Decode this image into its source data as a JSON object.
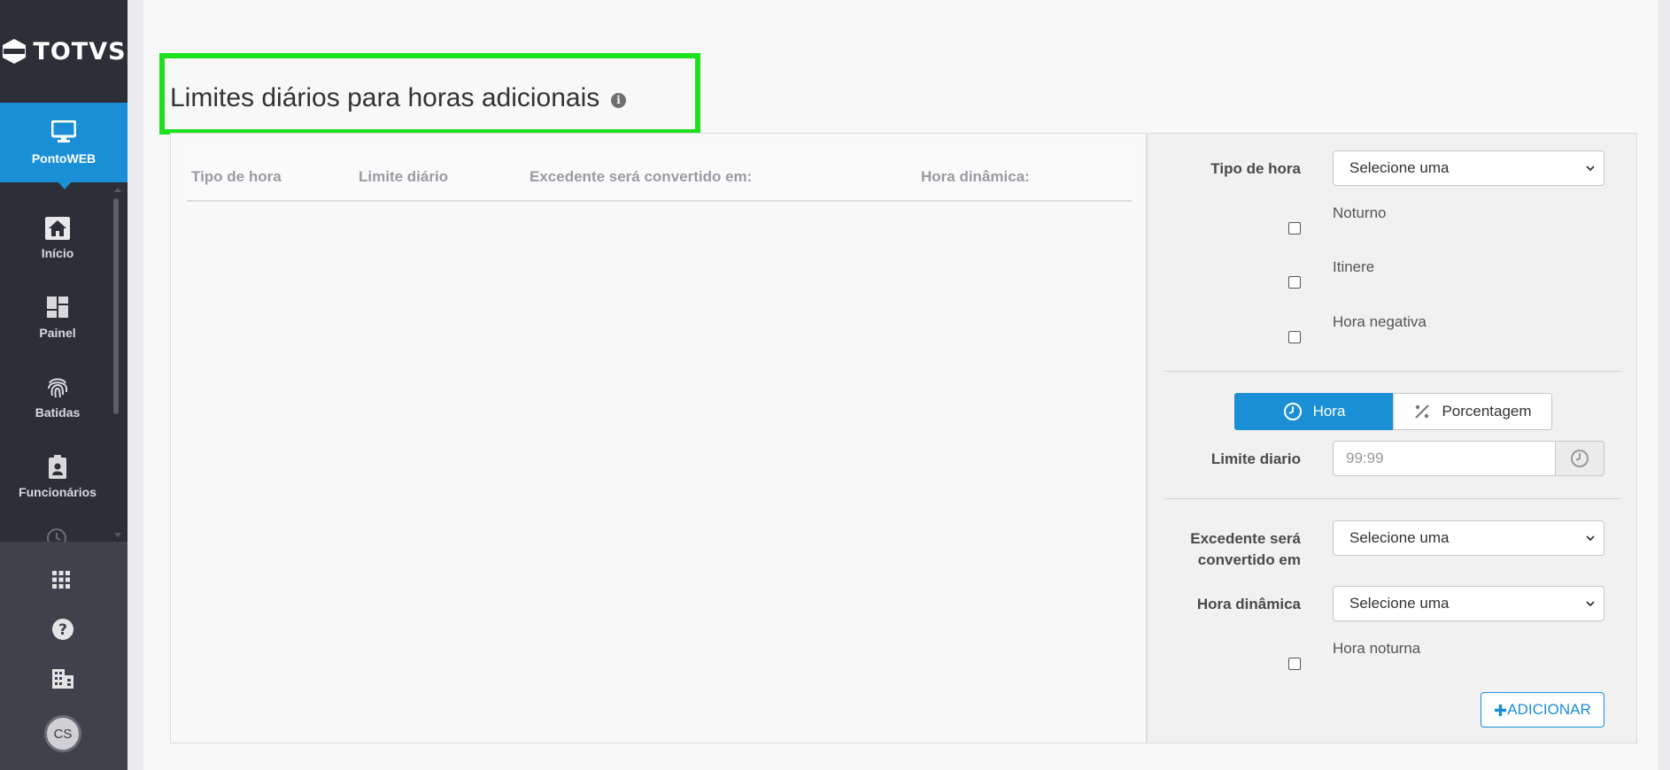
{
  "app": {
    "brand": "TOTVS"
  },
  "sidebar": {
    "active": {
      "label": "PontoWEB",
      "icon": "monitor-icon"
    },
    "items": [
      {
        "label": "Início",
        "icon": "home-icon"
      },
      {
        "label": "Painel",
        "icon": "dashboard-icon"
      },
      {
        "label": "Batidas",
        "icon": "fingerprint-icon"
      },
      {
        "label": "Funcionários",
        "icon": "badge-icon"
      }
    ],
    "bottom": {
      "apps_icon": "grid-icon",
      "help_icon": "help-icon",
      "company_icon": "building-icon",
      "avatar_initials": "CS"
    }
  },
  "page": {
    "title": "Limites diários para horas adicionais"
  },
  "table": {
    "columns": [
      "Tipo de hora",
      "Limite diário",
      "Excedente será convertido em:",
      "Hora dinâmica:"
    ],
    "rows": []
  },
  "form": {
    "tipo_hora": {
      "label": "Tipo de hora",
      "value": "Selecione uma"
    },
    "checks": [
      {
        "label": "Noturno",
        "checked": false
      },
      {
        "label": "Itinere",
        "checked": false
      },
      {
        "label": "Hora negativa",
        "checked": false
      }
    ],
    "mode": {
      "hora": "Hora",
      "porcentagem": "Porcentagem",
      "selected": "Hora"
    },
    "limite": {
      "label": "Limite diario",
      "placeholder": "99:99"
    },
    "excedente": {
      "label_line1": "Excedente será",
      "label_line2": "convertido em",
      "value": "Selecione uma"
    },
    "hora_dinamica": {
      "label": "Hora dinâmica",
      "value": "Selecione uma"
    },
    "hora_noturna": {
      "label": "Hora noturna",
      "checked": false
    },
    "add_button": "ADICIONAR"
  },
  "colors": {
    "accent": "#1a8fd6",
    "sidebar": "#2c2f36",
    "highlight": "#1fe01f"
  }
}
